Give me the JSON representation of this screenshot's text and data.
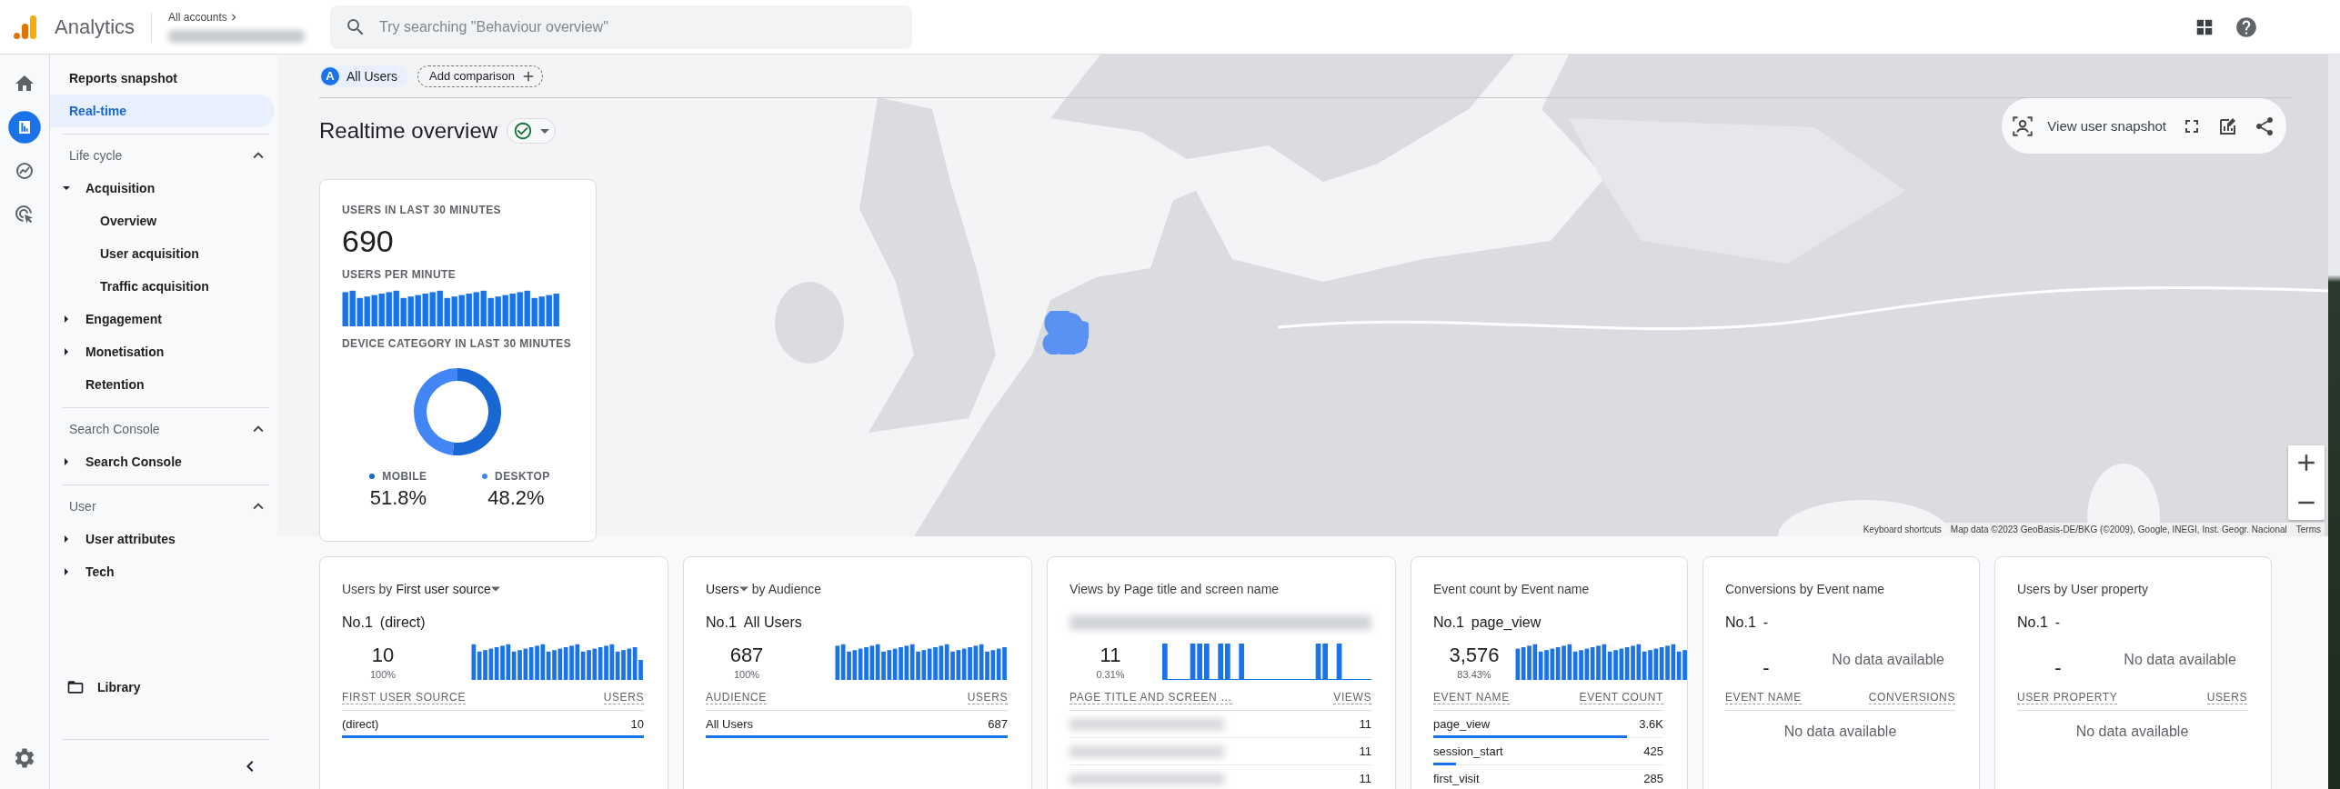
{
  "topbar": {
    "app_name": "Analytics",
    "breadcrumb": "All accounts"
  },
  "search": {
    "placeholder": "Try searching \"Behaviour overview\""
  },
  "rail": [
    {
      "kind": "home",
      "selected": false
    },
    {
      "kind": "reports",
      "selected": true
    },
    {
      "kind": "explore",
      "selected": false
    },
    {
      "kind": "advertising",
      "selected": false
    }
  ],
  "sidebar": {
    "items": [
      {
        "label": "Reports snapshot",
        "selected": false
      },
      {
        "label": "Real-time",
        "selected": true
      }
    ],
    "sections": [
      {
        "title": "Life cycle",
        "expanded": true,
        "items": [
          {
            "label": "Acquisition",
            "kind": "folder",
            "expanded": true,
            "children": [
              {
                "label": "Overview"
              },
              {
                "label": "User acquisition"
              },
              {
                "label": "Traffic acquisition"
              }
            ]
          },
          {
            "label": "Engagement",
            "kind": "folder",
            "expanded": false
          },
          {
            "label": "Monetisation",
            "kind": "folder",
            "expanded": false
          },
          {
            "label": "Retention",
            "kind": "page"
          }
        ]
      },
      {
        "title": "Search Console",
        "expanded": true,
        "items": [
          {
            "label": "Search Console",
            "kind": "folder",
            "expanded": false
          }
        ]
      },
      {
        "title": "User",
        "expanded": true,
        "items": [
          {
            "label": "User attributes",
            "kind": "folder",
            "expanded": false
          },
          {
            "label": "Tech",
            "kind": "folder",
            "expanded": false
          }
        ]
      }
    ],
    "library": "Library"
  },
  "comparison": {
    "segments": [
      {
        "badge": "A",
        "label": "All Users"
      }
    ],
    "add_label": "Add comparison"
  },
  "page_title": "Realtime overview",
  "snapshot_toolbar": {
    "label": "View user snapshot"
  },
  "map": {
    "kind": "picture",
    "attribution": [
      "Keyboard shortcuts",
      "Map data ©2023 GeoBasis-DE/BKG (©2009), Google, INEGI, Inst. Geogr. Nacional",
      "Terms"
    ]
  },
  "users_card": {
    "users_label": "USERS IN LAST 30 MINUTES",
    "users_value": "690",
    "per_minute_label": "USERS PER MINUTE",
    "chart_data": {
      "type": "donut",
      "title": "DEVICE CATEGORY IN LAST 30 MINUTES",
      "categories": [
        "MOBILE",
        "DESKTOP"
      ],
      "values": [
        51.8,
        48.2
      ],
      "value_labels": [
        "51.8%",
        "48.2%"
      ]
    }
  },
  "cards": [
    {
      "title": [
        {
          "text": "Users by",
          "dropdown": false
        },
        {
          "text": "First user source",
          "dropdown": true
        }
      ],
      "top_blurred": false,
      "rank": "No.1",
      "top_name": "(direct)",
      "top_value": "10",
      "top_share": "100%",
      "kind": "bars",
      "columns": [
        "FIRST USER SOURCE",
        "USERS"
      ],
      "rows": [
        {
          "name": "(direct)",
          "blurred": false,
          "value": "10",
          "level": 1
        }
      ]
    },
    {
      "title": [
        {
          "text": "Users",
          "dropdown": true
        },
        {
          "text": "by Audience",
          "dropdown": false
        }
      ],
      "top_blurred": false,
      "rank": "No.1",
      "top_name": "All Users",
      "top_value": "687",
      "top_share": "100%",
      "kind": "bars",
      "columns": [
        "AUDIENCE",
        "USERS"
      ],
      "rows": [
        {
          "name": "All Users",
          "blurred": false,
          "value": "687",
          "level": 1
        }
      ]
    },
    {
      "title": [
        {
          "text": "Views by Page title and screen name",
          "dropdown": false
        }
      ],
      "top_blurred": true,
      "top_value": "11",
      "top_share": "0.31%",
      "kind": "spikes",
      "columns": [
        "PAGE TITLE AND SCREEN …",
        "VIEWS"
      ],
      "rows": [
        {
          "blurred": true,
          "value": "11"
        },
        {
          "blurred": true,
          "value": "11"
        },
        {
          "blurred": true,
          "value": "11"
        }
      ]
    },
    {
      "title": [
        {
          "text": "Event count by Event name",
          "dropdown": false
        }
      ],
      "top_blurred": false,
      "rank": "No.1",
      "top_name": "page_view",
      "top_value": "3,576",
      "top_share": "83.43%",
      "kind": "bars",
      "columns": [
        "EVENT NAME",
        "EVENT COUNT"
      ],
      "rows": [
        {
          "name": "page_view",
          "blurred": false,
          "value": "3.6K",
          "level": 0.84
        },
        {
          "name": "session_start",
          "blurred": false,
          "value": "425",
          "level": 0.1
        },
        {
          "name": "first_visit",
          "blurred": false,
          "value": "285"
        }
      ]
    },
    {
      "title": [
        {
          "text": "Conversions by Event name",
          "dropdown": false
        }
      ],
      "top_blurred": false,
      "rank": "No.1",
      "top_name": "-",
      "top_value": "-",
      "kind": "empty",
      "chart_message": "No data available",
      "columns": [
        "EVENT NAME",
        "CONVERSIONS"
      ],
      "table_message": "No data available"
    },
    {
      "title": [
        {
          "text": "Users by User property",
          "dropdown": false
        }
      ],
      "top_blurred": false,
      "rank": "No.1",
      "top_name": "-",
      "top_value": "-",
      "kind": "empty",
      "chart_message": "No data available",
      "columns": [
        "USER PROPERTY",
        "USERS"
      ],
      "table_message": "No data available"
    }
  ]
}
